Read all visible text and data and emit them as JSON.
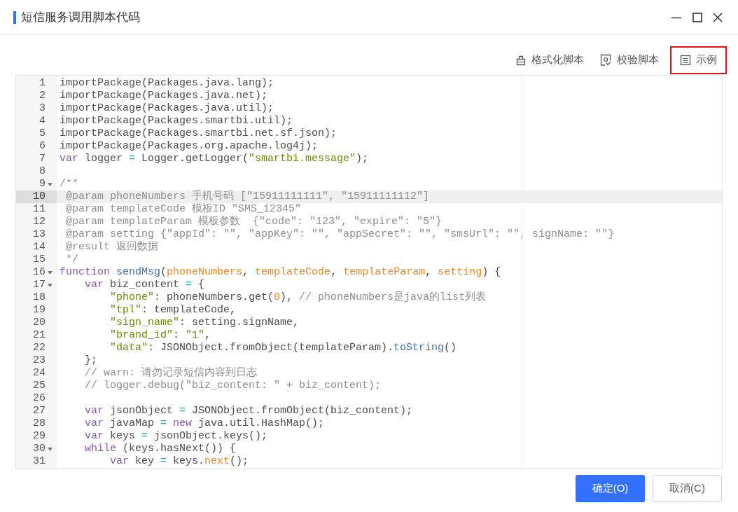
{
  "window": {
    "title": "短信服务调用脚本代码"
  },
  "toolbar": [
    {
      "label": "格式化脚本",
      "kind": "format",
      "highlighted": false
    },
    {
      "label": "校验脚本",
      "kind": "verify",
      "highlighted": false
    },
    {
      "label": "示例",
      "kind": "example",
      "highlighted": true
    }
  ],
  "editor": {
    "lines": [
      {
        "number": "1",
        "fold": false,
        "current": false,
        "tokens": [
          {
            "kind": "plain",
            "text": "importPackage(Packages.java.lang);"
          }
        ]
      },
      {
        "number": "2",
        "fold": false,
        "current": false,
        "tokens": [
          {
            "kind": "plain",
            "text": "importPackage(Packages.java.net);"
          }
        ]
      },
      {
        "number": "3",
        "fold": false,
        "current": false,
        "tokens": [
          {
            "kind": "plain",
            "text": "importPackage(Packages.java.util);"
          }
        ]
      },
      {
        "number": "4",
        "fold": false,
        "current": false,
        "tokens": [
          {
            "kind": "plain",
            "text": "importPackage(Packages.smartbi.util);"
          }
        ]
      },
      {
        "number": "5",
        "fold": false,
        "current": false,
        "tokens": [
          {
            "kind": "plain",
            "text": "importPackage(Packages.smartbi.net.sf.json);"
          }
        ]
      },
      {
        "number": "6",
        "fold": false,
        "current": false,
        "tokens": [
          {
            "kind": "plain",
            "text": "importPackage(Packages.org.apache.log4j);"
          }
        ]
      },
      {
        "number": "7",
        "fold": false,
        "current": false,
        "tokens": [
          {
            "kind": "keyword",
            "text": "var"
          },
          {
            "kind": "plain",
            "text": " logger "
          },
          {
            "kind": "operator",
            "text": "="
          },
          {
            "kind": "plain",
            "text": " Logger.getLogger("
          },
          {
            "kind": "string",
            "text": "\"smartbi.message\""
          },
          {
            "kind": "plain",
            "text": ");"
          }
        ]
      },
      {
        "number": "8",
        "fold": false,
        "current": false
      },
      {
        "number": "9",
        "fold": true,
        "current": false,
        "tokens": [
          {
            "kind": "comment",
            "text": "/**"
          }
        ]
      },
      {
        "number": "10",
        "fold": false,
        "current": true,
        "tokens": [
          {
            "kind": "comment",
            "text": " @param phoneNumbers 手机号码 [\"15911111111\", \"15911111112\"]"
          }
        ]
      },
      {
        "number": "11",
        "fold": false,
        "current": false,
        "tokens": [
          {
            "kind": "comment",
            "text": " @param templateCode 模板ID \"SMS_12345\""
          }
        ]
      },
      {
        "number": "12",
        "fold": false,
        "current": false,
        "tokens": [
          {
            "kind": "comment",
            "text": " @param templateParam 模板参数  {\"code\": \"123\", \"expire\": \"5\"}"
          }
        ]
      },
      {
        "number": "13",
        "fold": false,
        "current": false,
        "tokens": [
          {
            "kind": "comment",
            "text": " @param setting {\"appId\": \"\", \"appKey\": \"\", \"appSecret\": \"\", \"smsUrl\": \"\", signName: \"\"}"
          }
        ]
      },
      {
        "number": "14",
        "fold": false,
        "current": false,
        "tokens": [
          {
            "kind": "comment",
            "text": " @result 返回数据"
          }
        ]
      },
      {
        "number": "15",
        "fold": false,
        "current": false,
        "tokens": [
          {
            "kind": "comment",
            "text": " */"
          }
        ]
      },
      {
        "number": "16",
        "fold": true,
        "current": false,
        "tokens": [
          {
            "kind": "keyword",
            "text": "function"
          },
          {
            "kind": "function",
            "text": " sendMsg"
          },
          {
            "kind": "plain",
            "text": "("
          },
          {
            "kind": "param",
            "text": "phoneNumbers"
          },
          {
            "kind": "plain",
            "text": ", "
          },
          {
            "kind": "param",
            "text": "templateCode"
          },
          {
            "kind": "plain",
            "text": ", "
          },
          {
            "kind": "param",
            "text": "templateParam"
          },
          {
            "kind": "plain",
            "text": ", "
          },
          {
            "kind": "param",
            "text": "setting"
          },
          {
            "kind": "plain",
            "text": ") {"
          }
        ]
      },
      {
        "number": "17",
        "fold": true,
        "current": false,
        "tokens": [
          {
            "kind": "keyword",
            "text": "    var"
          },
          {
            "kind": "plain",
            "text": " biz_content "
          },
          {
            "kind": "operator",
            "text": "="
          },
          {
            "kind": "plain",
            "text": " {"
          }
        ]
      },
      {
        "number": "18",
        "fold": false,
        "current": false,
        "tokens": [
          {
            "kind": "string",
            "text": "        \"phone\""
          },
          {
            "kind": "plain",
            "text": ": phoneNumbers.get("
          },
          {
            "kind": "number",
            "text": "0"
          },
          {
            "kind": "plain",
            "text": "), "
          },
          {
            "kind": "comment",
            "text": "// phoneNumbers是java的list列表"
          }
        ]
      },
      {
        "number": "19",
        "fold": false,
        "current": false,
        "tokens": [
          {
            "kind": "string",
            "text": "        \"tpl\""
          },
          {
            "kind": "plain",
            "text": ": templateCode,"
          }
        ]
      },
      {
        "number": "20",
        "fold": false,
        "current": false,
        "tokens": [
          {
            "kind": "string",
            "text": "        \"sign_name\""
          },
          {
            "kind": "plain",
            "text": ": setting.signName,"
          }
        ]
      },
      {
        "number": "21",
        "fold": false,
        "current": false,
        "tokens": [
          {
            "kind": "string",
            "text": "        \"brand_id\""
          },
          {
            "kind": "plain",
            "text": ": "
          },
          {
            "kind": "string",
            "text": "\"1\""
          },
          {
            "kind": "plain",
            "text": ","
          }
        ]
      },
      {
        "number": "22",
        "fold": false,
        "current": false,
        "tokens": [
          {
            "kind": "string",
            "text": "        \"data\""
          },
          {
            "kind": "plain",
            "text": ": JSONObject.fromObject(templateParam)."
          },
          {
            "kind": "function",
            "text": "toString"
          },
          {
            "kind": "plain",
            "text": "()"
          }
        ]
      },
      {
        "number": "23",
        "fold": false,
        "current": false,
        "tokens": [
          {
            "kind": "plain",
            "text": "    };"
          }
        ]
      },
      {
        "number": "24",
        "fold": false,
        "current": false,
        "tokens": [
          {
            "kind": "comment",
            "text": "    // warn: 请勿记录短信内容到日志"
          }
        ]
      },
      {
        "number": "25",
        "fold": false,
        "current": false,
        "tokens": [
          {
            "kind": "comment",
            "text": "    // logger.debug(\"biz_content: \" + biz_content);"
          }
        ]
      },
      {
        "number": "26",
        "fold": false,
        "current": false
      },
      {
        "number": "27",
        "fold": false,
        "current": false,
        "tokens": [
          {
            "kind": "keyword",
            "text": "    var"
          },
          {
            "kind": "plain",
            "text": " jsonObject "
          },
          {
            "kind": "operator",
            "text": "="
          },
          {
            "kind": "plain",
            "text": " JSONObject.fromObject(biz_content);"
          }
        ]
      },
      {
        "number": "28",
        "fold": false,
        "current": false,
        "tokens": [
          {
            "kind": "keyword",
            "text": "    var"
          },
          {
            "kind": "plain",
            "text": " javaMap "
          },
          {
            "kind": "operator",
            "text": "="
          },
          {
            "kind": "keyword",
            "text": " new"
          },
          {
            "kind": "plain",
            "text": " java.util.HashMap();"
          }
        ]
      },
      {
        "number": "29",
        "fold": false,
        "current": false,
        "tokens": [
          {
            "kind": "keyword",
            "text": "    var"
          },
          {
            "kind": "plain",
            "text": " keys "
          },
          {
            "kind": "operator",
            "text": "="
          },
          {
            "kind": "plain",
            "text": " jsonObject.keys();"
          }
        ]
      },
      {
        "number": "30",
        "fold": true,
        "current": false,
        "tokens": [
          {
            "kind": "keyword",
            "text": "    while"
          },
          {
            "kind": "plain",
            "text": " (keys.hasNext()) {"
          }
        ]
      },
      {
        "number": "31",
        "fold": false,
        "current": false,
        "tokens": [
          {
            "kind": "keyword",
            "text": "        var"
          },
          {
            "kind": "plain",
            "text": " key "
          },
          {
            "kind": "operator",
            "text": "="
          },
          {
            "kind": "plain",
            "text": " keys."
          },
          {
            "kind": "number",
            "text": "next"
          },
          {
            "kind": "plain",
            "text": "();"
          }
        ]
      }
    ]
  },
  "buttons": [
    {
      "label": "确定(O)",
      "kind": "primary"
    },
    {
      "label": "取消(C)",
      "kind": "secondary"
    }
  ]
}
